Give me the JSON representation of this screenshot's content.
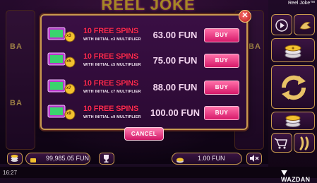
{
  "game": {
    "title": "Reel Joke™",
    "logo_text": "REEL JOKE",
    "reel_letters": [
      "BA",
      "BA",
      "BA"
    ]
  },
  "modal": {
    "offers": [
      {
        "free_spins": "10 FREE SPINS",
        "subtitle": "WITH INITIAL x3 MULTIPLIER",
        "multiplier_badge": "x3",
        "price": "63.00 FUN",
        "buy_label": "BUY"
      },
      {
        "free_spins": "10 FREE SPINS",
        "subtitle": "WITH INITIAL x5 MULTIPLIER",
        "multiplier_badge": "x5",
        "price": "75.00 FUN",
        "buy_label": "BUY"
      },
      {
        "free_spins": "10 FREE SPINS",
        "subtitle": "WITH INITIAL x7 MULTIPLIER",
        "multiplier_badge": "x7",
        "price": "88.00 FUN",
        "buy_label": "BUY"
      },
      {
        "free_spins": "10 FREE SPINS",
        "subtitle": "WITH INITIAL x9 MULTIPLIER",
        "multiplier_badge": "x9",
        "price": "100.00 FUN",
        "buy_label": "BUY"
      }
    ],
    "cancel_label": "CANCEL",
    "close_symbol": "✕"
  },
  "bottom_bar": {
    "balance": "99,985.05 FUN",
    "bet": "1.00 FUN"
  },
  "status": {
    "clock": "16:27",
    "brand": "WAZDAN"
  },
  "colors": {
    "accent_gold": "#c99a4f",
    "buy_pink": "#d61a6a",
    "title_red": "#ff2a55",
    "panel_purple": "#2b0a33"
  },
  "icons": [
    "close-icon",
    "autoplay-icon",
    "turbo-icon",
    "coins-icon",
    "spin-icon",
    "bet-coins-icon",
    "cart-icon",
    "chili-icon",
    "menu-icon",
    "trophy-icon",
    "sound-icon"
  ]
}
